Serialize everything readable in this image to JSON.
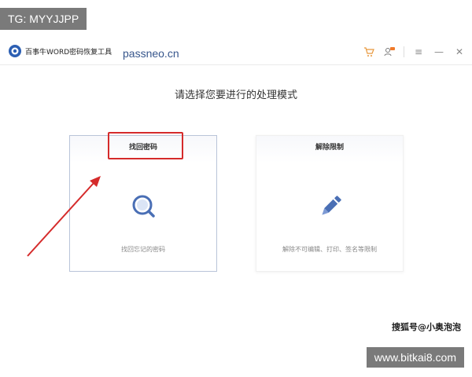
{
  "overlay": {
    "tg_tag": "TG: MYYJJPP",
    "domain_watermark": "passneo.cn",
    "sohu_watermark": "搜狐号@小奥泡泡",
    "site_tag": "www.bitkai8.com"
  },
  "titlebar": {
    "app_title": "百事牛WORD密码恢复工具",
    "icons": [
      "app-logo-icon",
      "cart-icon",
      "user-vip-icon",
      "menu-icon",
      "minimize-icon",
      "close-icon"
    ]
  },
  "main": {
    "heading": "请选择您要进行的处理模式",
    "cards": [
      {
        "title": "找回密码",
        "desc": "找回忘记的密码",
        "icon": "search-icon"
      },
      {
        "title": "解除限制",
        "desc": "解除不可编辑、打印、签名等限制",
        "icon": "pencil-icon"
      }
    ]
  },
  "colors": {
    "accent": "#4a6fb5",
    "highlight": "#d52b2b"
  }
}
